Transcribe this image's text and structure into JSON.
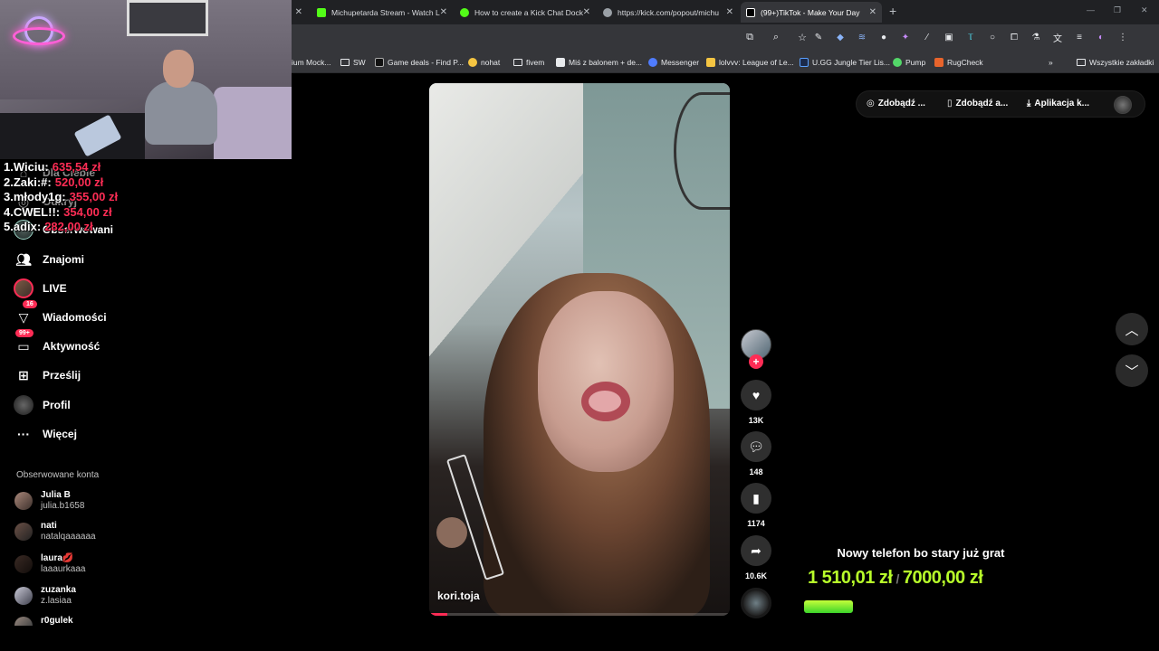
{
  "browser": {
    "tabs": [
      {
        "label": "Michupetarda Stream - Watch L",
        "color": "#53fc18"
      },
      {
        "label": "How to create a Kick Chat Dock",
        "color": "#53fc18"
      },
      {
        "label": "https://kick.com/popout/michu",
        "color": "#9aa0a6"
      },
      {
        "label": "(99+)TikTok - Make Your Day",
        "color": "#ffffff"
      }
    ],
    "new_tab": "+",
    "bookmarks": [
      {
        "label": "ium Mock...",
        "kind": "page"
      },
      {
        "label": "SW",
        "kind": "folder"
      },
      {
        "label": "Game deals - Find P...",
        "kind": "page"
      },
      {
        "label": "nohat",
        "kind": "page"
      },
      {
        "label": "fivem",
        "kind": "folder"
      },
      {
        "label": "Miś z balonem + de...",
        "kind": "page"
      },
      {
        "label": "Messenger",
        "kind": "page"
      },
      {
        "label": "lolvvv: League of Le...",
        "kind": "page"
      },
      {
        "label": "U.GG Jungle Tier Lis...",
        "kind": "page"
      },
      {
        "label": "Pump",
        "kind": "page"
      },
      {
        "label": "RugCheck",
        "kind": "page"
      }
    ],
    "bookmarks_more": "»",
    "all_bookmarks": "Wszystkie zakładki"
  },
  "leaderboard": [
    {
      "rank_name": "1.Wiciu:",
      "amount": "635,54 zł"
    },
    {
      "rank_name": "2.Zaki:#:",
      "amount": "520,00 zł"
    },
    {
      "rank_name": "3.młody1g:",
      "amount": "355,00 zł"
    },
    {
      "rank_name": "4.CWEL!!:",
      "amount": "354,00 zł"
    },
    {
      "rank_name": "5.adix:",
      "amount": "282,00 zł"
    }
  ],
  "sidebar": {
    "hidden_items": [
      "Dla Ciebie",
      "Odkryj"
    ],
    "items": [
      {
        "label": "Obserwowani",
        "icon": "following-icon"
      },
      {
        "label": "Znajomi",
        "icon": "friends-icon"
      },
      {
        "label": "LIVE",
        "icon": "live-icon"
      },
      {
        "label": "Wiadomości",
        "icon": "messages-icon",
        "badge": "16"
      },
      {
        "label": "Aktywność",
        "icon": "activity-icon",
        "badge": "99+"
      },
      {
        "label": "Prześlij",
        "icon": "upload-icon"
      },
      {
        "label": "Profil",
        "icon": "profile-icon"
      },
      {
        "label": "Więcej",
        "icon": "more-icon"
      }
    ],
    "followed_heading": "Obserwowane konta",
    "accounts": [
      {
        "name": "Julia B",
        "handle": "julia.b1658"
      },
      {
        "name": "nati",
        "handle": "natalqaaaaaa"
      },
      {
        "name": "laura💋",
        "handle": "laaaurkaaa"
      },
      {
        "name": "zuzanka",
        "handle": "z.lasiaa"
      },
      {
        "name": "r0gulek",
        "handle": ""
      }
    ]
  },
  "video": {
    "author": "kori.toja",
    "progress": 0.06
  },
  "actions": {
    "likes": "13K",
    "comments": "148",
    "saves": "1174",
    "shares": "10.6K"
  },
  "header": {
    "btn1": "Zdobądź ...",
    "btn2": "Zdobądź a...",
    "btn3": "Aplikacja k..."
  },
  "goal": {
    "title": "Nowy telefon bo stary już grat",
    "current": "1 510,01 zł",
    "separator": "/",
    "target": "7000,00 zł",
    "progress": 0.2157
  },
  "colors": {
    "accent": "#fe2c55",
    "goal_green": "#b8ff2a"
  }
}
